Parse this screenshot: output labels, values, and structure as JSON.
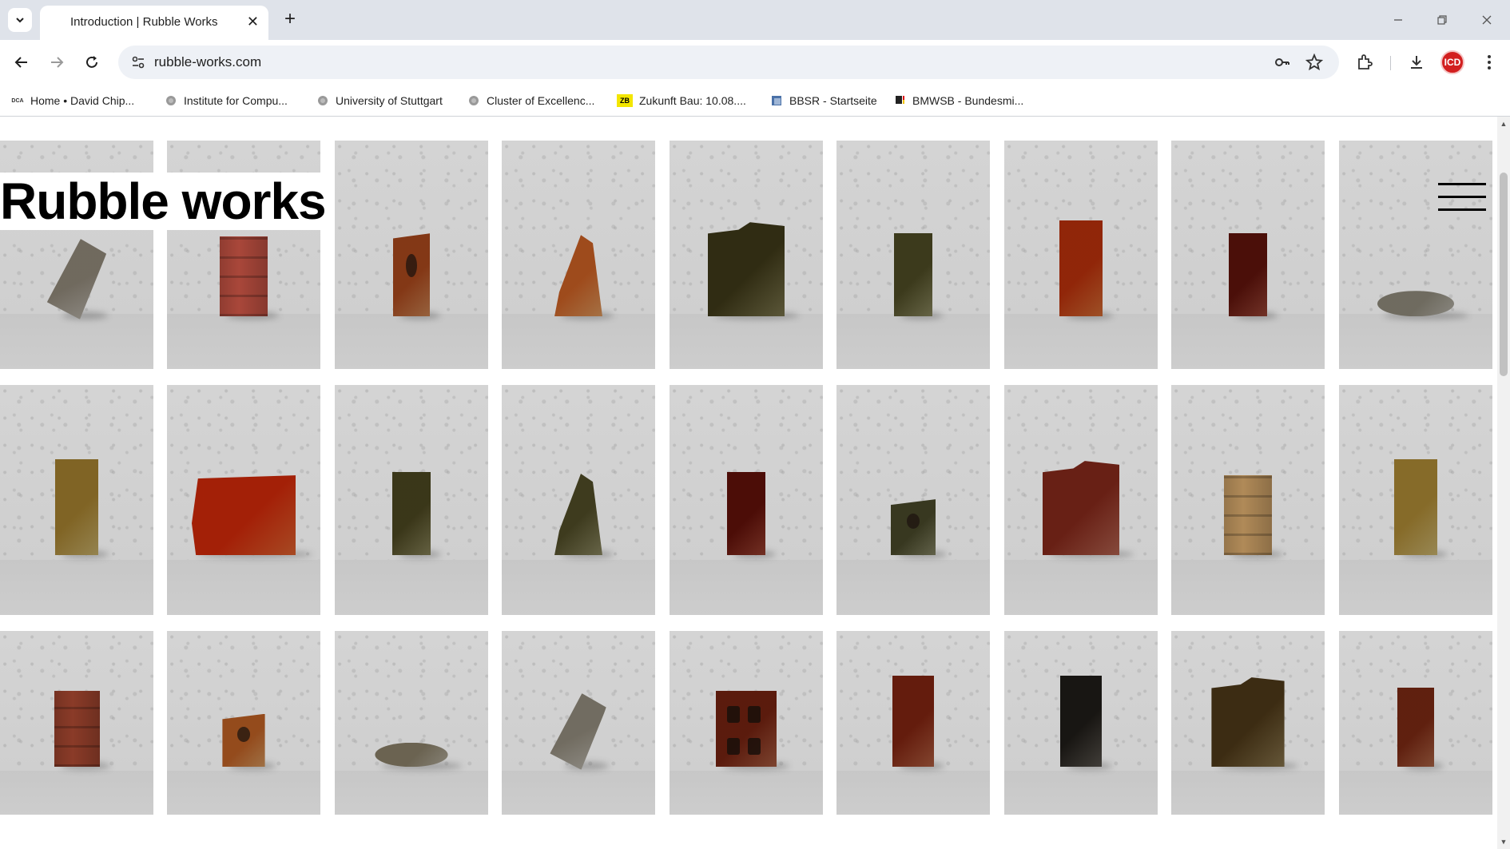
{
  "browser": {
    "tab_title": "Introduction | Rubble Works",
    "url": "rubble-works.com",
    "profile_initials": "ICD",
    "bookmarks": [
      {
        "label": "Home • David Chip...",
        "icon": "dca-favicon"
      },
      {
        "label": "Institute for Compu...",
        "icon": "globe-favicon"
      },
      {
        "label": "University of Stuttgart",
        "icon": "globe-favicon"
      },
      {
        "label": "Cluster of Excellenc...",
        "icon": "globe-favicon"
      },
      {
        "label": "Zukunft Bau: 10.08....",
        "icon": "zb-favicon"
      },
      {
        "label": "BBSR - Startseite",
        "icon": "bbsr-favicon"
      },
      {
        "label": "BMWSB - Bundesmi...",
        "icon": "eagle-favicon"
      }
    ]
  },
  "page": {
    "site_title": "Rubble works",
    "menu_icon": "hamburger-icon",
    "gallery": {
      "rows": [
        [
          {
            "kind": "stone",
            "color": "#a9a49b"
          },
          {
            "kind": "ribbed-brick",
            "color": "#a9473a"
          },
          {
            "kind": "holed-brick",
            "color": "#b7774b"
          },
          {
            "kind": "shard",
            "color": "#c98a54"
          },
          {
            "kind": "mossy-block",
            "color": "#6f6a45"
          },
          {
            "kind": "narrow-block",
            "color": "#7c7a55"
          },
          {
            "kind": "brick",
            "color": "#c0622f"
          },
          {
            "kind": "narrow-block",
            "color": "#8a3e30"
          },
          {
            "kind": "flat-stone",
            "color": "#a8a59c"
          }
        ],
        [
          {
            "kind": "brick",
            "color": "#b5a061"
          },
          {
            "kind": "wide-block",
            "color": "#cc5a2b"
          },
          {
            "kind": "narrow-block",
            "color": "#7a7650"
          },
          {
            "kind": "shard",
            "color": "#7e7b58"
          },
          {
            "kind": "narrow-block",
            "color": "#8b3a2b"
          },
          {
            "kind": "holed-block",
            "color": "#77775a"
          },
          {
            "kind": "mossy-block",
            "color": "#a35a49"
          },
          {
            "kind": "ribbed-brick",
            "color": "#b08a58"
          },
          {
            "kind": "brick",
            "color": "#b9a566"
          }
        ],
        [
          {
            "kind": "ribbed-brick",
            "color": "#8a3b28"
          },
          {
            "kind": "holed-block",
            "color": "#c28a55"
          },
          {
            "kind": "flat-stone",
            "color": "#a59f90"
          },
          {
            "kind": "stone",
            "color": "#aaa69d"
          },
          {
            "kind": "perforated-brick",
            "color": "#98533a"
          },
          {
            "kind": "brick",
            "color": "#a0553a"
          },
          {
            "kind": "brick",
            "color": "#4f4b45"
          },
          {
            "kind": "mossy-block",
            "color": "#7c6a45"
          },
          {
            "kind": "narrow-block",
            "color": "#9c5a3e"
          }
        ]
      ]
    }
  }
}
